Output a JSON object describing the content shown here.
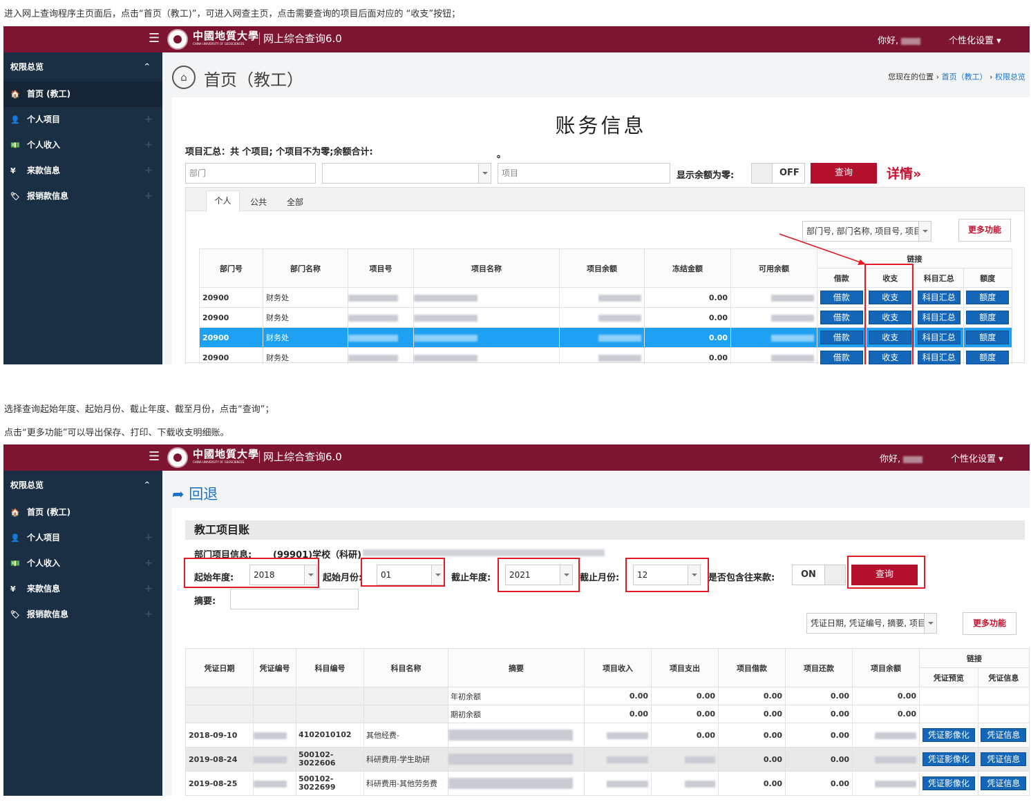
{
  "captions": {
    "c1": "进入网上查询程序主页面后，点击“首页（教工)”，可进入网查主页，点击需要查询的项目后面对应的 “收支”按钮；",
    "c2": "选择查询起始年度、起始月份、截止年度、截至月份，点击“查询”；",
    "c3": "点击“更多功能”可以导出保存、打印、下载收支明细账。"
  },
  "header": {
    "menu_icon": "☰",
    "school_name": "中國地質大學",
    "school_sub": "CHINA UNIVERSITY OF GEOSCIENCES",
    "system_name": "网上综合查询6.0",
    "greeting": "你好,",
    "personal_settings": "个性化设置"
  },
  "sidebar": {
    "section": "权限总览",
    "caret": "^",
    "items": [
      {
        "icon": "🏠",
        "label": "首页 (教工)"
      },
      {
        "icon": "👤",
        "label": "个人项目"
      },
      {
        "icon": "💵",
        "label": "个人收入"
      },
      {
        "icon": "¥",
        "label": "来款信息"
      },
      {
        "icon": "🏷",
        "label": "报销款信息"
      }
    ],
    "plus": "+"
  },
  "screen1": {
    "page_title": "首页（教工）",
    "crumb_prefix": "您现在的位置",
    "crumb_home": "首页（教工）",
    "crumb_current": "权限总览",
    "card_title": "账务信息",
    "summary": "项目汇总：共    个项目;    个项目不为零;余额合计:",
    "summary_dot": "。",
    "dept_placeholder": "部门",
    "proj_placeholder": "项目",
    "show_zero_label": "显示余额为零:",
    "toggle_off": "OFF",
    "query": "查询",
    "details": "详情»",
    "tabs": [
      "个人",
      "公共",
      "全部"
    ],
    "column_select": "部门号, 部门名称, 项目号, 项目",
    "more": "更多功能",
    "headers": [
      "部门号",
      "部门名称",
      "项目号",
      "项目名称",
      "项目余额",
      "冻结金额",
      "可用余额"
    ],
    "link_header": "链接",
    "link_cols": [
      "借款",
      "收支",
      "科目汇总",
      "额度"
    ],
    "rows": [
      {
        "dept": "20900",
        "name": "财务处",
        "frozen": "0.00"
      },
      {
        "dept": "20900",
        "name": "财务处",
        "frozen": "0.00"
      },
      {
        "dept": "20900",
        "name": "财务处",
        "frozen": "0.00"
      },
      {
        "dept": "20900",
        "name": "财务处",
        "frozen": "0.00"
      }
    ],
    "row_btns": [
      "借款",
      "收支",
      "科目汇总",
      "额度"
    ]
  },
  "screen2": {
    "back": "回退",
    "card_title": "教工项目账",
    "info_label": "部门项目信息:",
    "info_value": "(99901)学校（科研)",
    "start_year_label": "起始年度:",
    "start_year": "2018",
    "start_month_label": "起始月份:",
    "start_month": "01",
    "end_year_label": "截止年度:",
    "end_year": "2021",
    "end_month_label": "截止月份:",
    "end_month": "12",
    "include_label": "是否包含往来款:",
    "toggle_on": "ON",
    "query": "查询",
    "summary_label": "摘要:",
    "column_select": "凭证日期, 凭证编号, 摘要, 项目",
    "more": "更多功能",
    "headers": [
      "凭证日期",
      "凭证编号",
      "科目编号",
      "科目名称",
      "摘要",
      "项目收入",
      "项目支出",
      "项目借款",
      "项目还款",
      "项目余额"
    ],
    "link_header": "链接",
    "link_cols": [
      "凭证预览",
      "凭证信息"
    ],
    "balance_rows": [
      {
        "summary": "年初余额",
        "vals": [
          "0.00",
          "0.00",
          "0.00",
          "0.00",
          "0.00"
        ]
      },
      {
        "summary": "期初余额",
        "vals": [
          "0.00",
          "0.00",
          "0.00",
          "0.00",
          "0.00"
        ]
      }
    ],
    "rows": [
      {
        "date": "2018-09-10",
        "subj_no": "4102010102",
        "subj_name": "其他经费-",
        "exp": "0.00",
        "loan": "0.00",
        "repay": "0.00"
      },
      {
        "date": "2019-08-24",
        "subj_no": "500102-3022606",
        "subj_name": "科研费用-学生助研",
        "exp": "",
        "loan": "0.00",
        "repay": "0.00"
      },
      {
        "date": "2019-08-25",
        "subj_no": "500102-3022699",
        "subj_name": "科研费用-其他劳务费",
        "exp": "",
        "loan": "0.00",
        "repay": "0.00"
      }
    ],
    "row_btns": [
      "凭证影像化",
      "凭证信息"
    ]
  }
}
